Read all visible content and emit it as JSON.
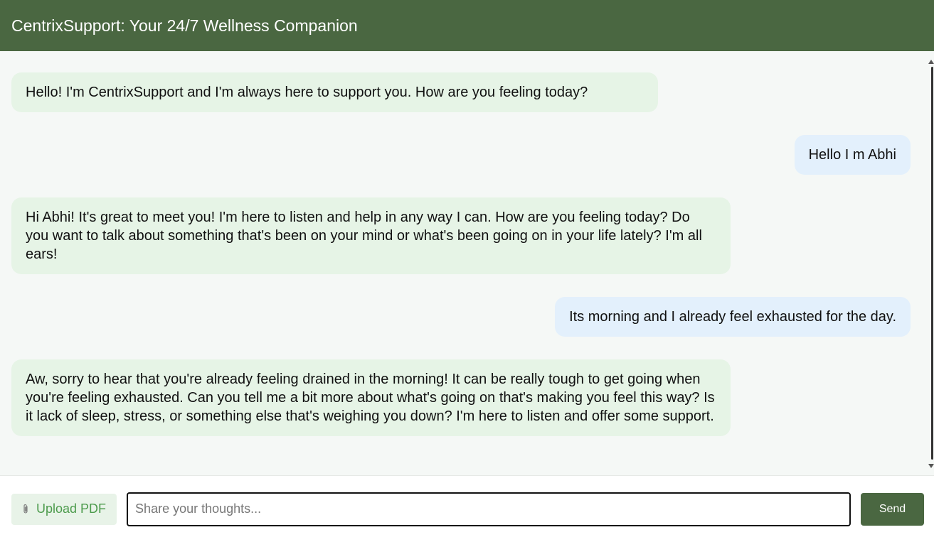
{
  "header": {
    "title": "CentrixSupport: Your 24/7 Wellness Companion"
  },
  "messages": [
    {
      "role": "bot",
      "text": "Hello! I'm CentrixSupport and I'm always here to support you. How are you feeling today?"
    },
    {
      "role": "user",
      "text": "Hello I m Abhi"
    },
    {
      "role": "bot",
      "text": "Hi Abhi! It's great to meet you! I'm here to listen and help in any way I can. How are you feeling today? Do you want to talk about something that's been on your mind or what's been going on in your life lately? I'm all ears!"
    },
    {
      "role": "user",
      "text": "Its morning and I already feel exhausted for the day."
    },
    {
      "role": "bot",
      "text": "Aw, sorry to hear that you're already feeling drained in the morning! It can be really tough to get going when you're feeling exhausted. Can you tell me a bit more about what's going on that's making you feel this way? Is it lack of sleep, stress, or something else that's weighing you down? I'm here to listen and offer some support."
    }
  ],
  "footer": {
    "upload_label": "Upload PDF",
    "upload_icon": "paperclip-icon",
    "input_value": "",
    "input_placeholder": "Share your thoughts...",
    "send_label": "Send"
  },
  "colors": {
    "brand": "#4a6741",
    "bot_bubble": "#e6f4e6",
    "user_bubble": "#e3f0fc",
    "upload_text": "#4c9b4c"
  }
}
